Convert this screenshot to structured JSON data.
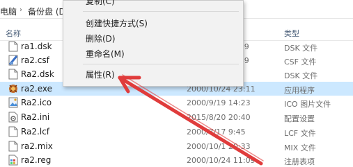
{
  "breadcrumb": {
    "items": [
      "电脑",
      "备份盘 (D"
    ]
  },
  "columns": {
    "name": "名称",
    "type": "类型"
  },
  "files": [
    {
      "name": "ra1.dsk",
      "date": ":29",
      "type": "DSK 文件",
      "icon": "file-icon"
    },
    {
      "name": "ra2.csf",
      "date": ":49",
      "type": "CSF 文件",
      "icon": "csf-file-icon"
    },
    {
      "name": "Ra2.dsk",
      "date": "2",
      "type": "DSK 文件",
      "icon": "file-icon"
    },
    {
      "name": "ra2.exe",
      "date": "2000/10/24 23:11",
      "type": "应用程序",
      "icon": "game-app-icon",
      "selected": true
    },
    {
      "name": "Ra2.ico",
      "date": "2000/9/19 14:23",
      "type": "ICO 图片文件",
      "icon": "ico-image-icon"
    },
    {
      "name": "Ra2.ini",
      "date": "2015/8/20 20:40",
      "type": "配置设置",
      "icon": "settings-file-icon"
    },
    {
      "name": "Ra2.lcf",
      "date": "2000/7/17 9:45",
      "type": "LCF 文件",
      "icon": "file-icon"
    },
    {
      "name": "ra2.mix",
      "date": "2000/10/1 20:33",
      "type": "MIX 文件",
      "icon": "file-icon"
    },
    {
      "name": "ra2.reg",
      "date": "2000/10/24 11:09",
      "type": "注册表项",
      "icon": "registry-file-icon"
    }
  ],
  "context_menu": {
    "top_partial": "复制(C)",
    "items": [
      "创建快捷方式(S)",
      "删除(D)",
      "重命名(M)"
    ],
    "properties": "属性(R)"
  },
  "annotation": {
    "arrow_color": "#e03c3c"
  }
}
